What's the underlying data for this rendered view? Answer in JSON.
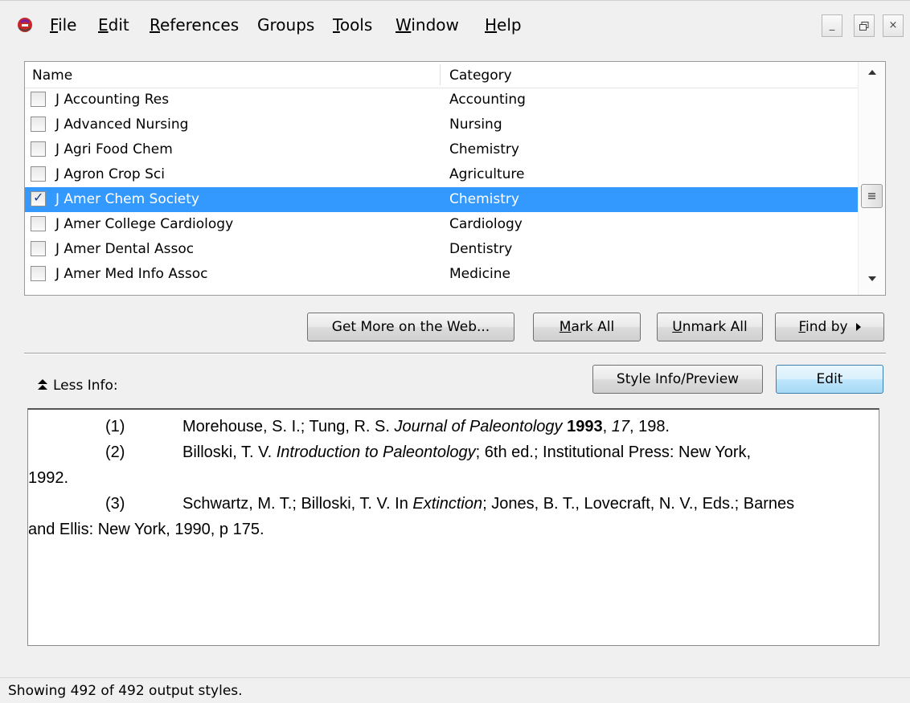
{
  "menu": {
    "items": [
      {
        "label_pre": "",
        "accel": "F",
        "label_post": "ile"
      },
      {
        "label_pre": "",
        "accel": "E",
        "label_post": "dit"
      },
      {
        "label_pre": "",
        "accel": "R",
        "label_post": "eferences"
      },
      {
        "label_pre": "Groups",
        "accel": "",
        "label_post": ""
      },
      {
        "label_pre": "",
        "accel": "T",
        "label_post": "ools"
      },
      {
        "label_pre": "",
        "accel": "W",
        "label_post": "indow"
      },
      {
        "label_pre": "",
        "accel": "H",
        "label_post": "elp"
      }
    ],
    "window_buttons": {
      "minimize": "_",
      "restore": "ꟹ",
      "close": "×"
    }
  },
  "list": {
    "columns": {
      "name": "Name",
      "category": "Category"
    },
    "rows": [
      {
        "name": "J Accounting Res",
        "category": "Accounting",
        "checked": false,
        "selected": false
      },
      {
        "name": "J Advanced Nursing",
        "category": "Nursing",
        "checked": false,
        "selected": false
      },
      {
        "name": "J Agri Food Chem",
        "category": "Chemistry",
        "checked": false,
        "selected": false
      },
      {
        "name": "J Agron Crop Sci",
        "category": "Agriculture",
        "checked": false,
        "selected": false
      },
      {
        "name": "J Amer Chem Society",
        "category": "Chemistry",
        "checked": true,
        "selected": true
      },
      {
        "name": "J Amer College Cardiology",
        "category": "Cardiology",
        "checked": false,
        "selected": false
      },
      {
        "name": "J Amer Dental Assoc",
        "category": "Dentistry",
        "checked": false,
        "selected": false
      },
      {
        "name": "J Amer Med Info Assoc",
        "category": "Medicine",
        "checked": false,
        "selected": false
      }
    ]
  },
  "buttons": {
    "get_more": "Get More on the Web...",
    "mark_all_accel": "M",
    "mark_all_rest": "ark All",
    "unmark_all_accel": "U",
    "unmark_all_rest": "nmark All",
    "find_by_accel": "F",
    "find_by_rest": "ind by",
    "style_info": "Style Info/Preview",
    "edit": "Edit"
  },
  "less_info": "Less Info:",
  "preview": {
    "refs": [
      {
        "num": "(1)"
      },
      {
        "num": "(2)"
      },
      {
        "num": "(3)"
      }
    ],
    "r1_authors": "Morehouse, S. I.; Tung, R. S. ",
    "r1_journal": "Journal of Paleontology",
    "r1_year": "1993",
    "r1_volume": "17",
    "r1_pages": ", 198.",
    "r2_authors": "Billoski, T. V. ",
    "r2_title": "Introduction to Paleontology",
    "r2_rest": "; 6th ed.; Institutional Press: New York,",
    "r2_cont": "1992.",
    "r3_authors": "Schwartz, M. T.; Billoski, T. V. In ",
    "r3_book": "Extinction",
    "r3_rest": "; Jones, B. T., Lovecraft, N. V., Eds.; Barnes",
    "r3_cont": "and Ellis: New York, 1990, p 175."
  },
  "status": "Showing 492 of 492 output styles.",
  "colors": {
    "selection": "#3399ff",
    "default_button_border": "#3c7fb1"
  }
}
